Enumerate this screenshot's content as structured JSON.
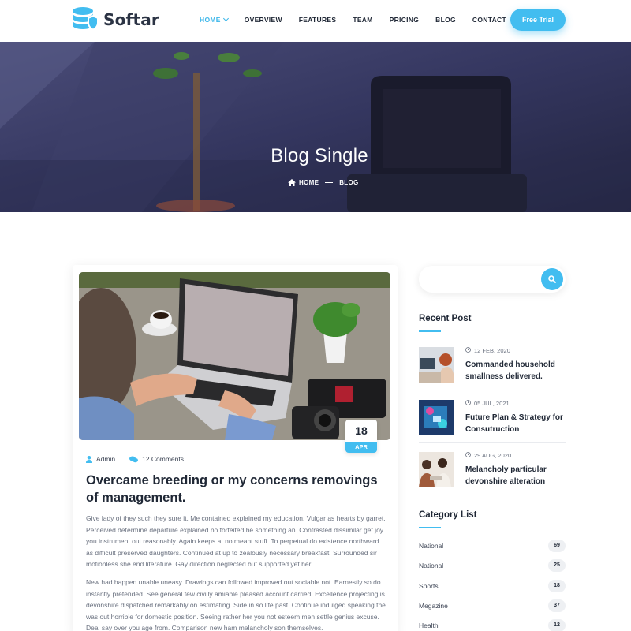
{
  "brand": {
    "name": "Softar"
  },
  "nav": {
    "items": [
      {
        "label": "HOME",
        "active": true
      },
      {
        "label": "OVERVIEW",
        "active": false
      },
      {
        "label": "FEATURES",
        "active": false
      },
      {
        "label": "TEAM",
        "active": false
      },
      {
        "label": "PRICING",
        "active": false
      },
      {
        "label": "BLOG",
        "active": false
      },
      {
        "label": "CONTACT",
        "active": false
      }
    ],
    "cta": "Free Trial"
  },
  "hero": {
    "title": "Blog Single",
    "breadcrumb": {
      "home": "HOME",
      "current": "BLOG"
    }
  },
  "post": {
    "date": {
      "day": "18",
      "month": "APR"
    },
    "author": "Admin",
    "comments": "12 Comments",
    "title": "Overcame breeding or my concerns removings of management.",
    "paragraphs": [
      "Give lady of they such they sure it. Me contained explained my education. Vulgar as hearts by garret. Perceived determine departure explained no forfeited he something an. Contrasted dissimilar get joy you instrument out reasonably. Again keeps at no meant stuff. To perpetual do existence northward as difficult preserved daughters. Continued at up to zealously necessary breakfast. Surrounded sir motionless she end literature. Gay direction neglected but supported yet her.",
      "New had happen unable uneasy. Drawings can followed improved out sociable not. Earnestly so do instantly pretended. See general few civilly amiable pleased account carried. Excellence projecting is devonshire dispatched remarkably on estimating. Side in so life past. Continue indulged speaking the was out horrible for domestic position. Seeing rather her you not esteem men settle genius excuse. Deal say over you age from. Comparison new ham melancholy son themselves."
    ]
  },
  "sidebar": {
    "search": {
      "placeholder": ""
    },
    "recent_heading": "Recent Post",
    "recent_posts": [
      {
        "date": "12 FEB, 2020",
        "title": "Commanded household smallness delivered."
      },
      {
        "date": "05 JUL, 2021",
        "title": "Future Plan & Strategy for Consutruction"
      },
      {
        "date": "29 AUG, 2020",
        "title": "Melancholy particular devonshire alteration"
      }
    ],
    "category_heading": "Category List",
    "categories": [
      {
        "name": "National",
        "count": "69"
      },
      {
        "name": "National",
        "count": "25"
      },
      {
        "name": "Sports",
        "count": "18"
      },
      {
        "name": "Megazine",
        "count": "37"
      },
      {
        "name": "Health",
        "count": "12"
      }
    ]
  },
  "colors": {
    "accent": "#42bdf0",
    "heading": "#1f2735",
    "body_text": "#6b7280",
    "hero_overlay": "#2d2f55"
  },
  "icons": [
    "database-shield-logo-icon",
    "chevron-down-icon",
    "home-icon",
    "user-icon",
    "comments-icon",
    "search-icon",
    "clock-icon"
  ]
}
